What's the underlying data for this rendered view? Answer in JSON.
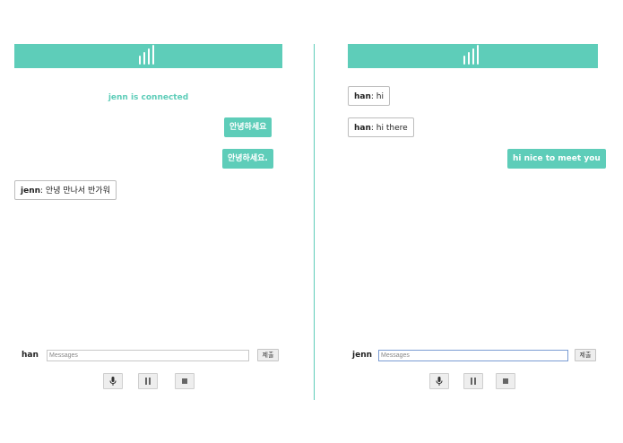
{
  "left": {
    "status": "jenn is connected",
    "messages": [
      {
        "type": "self",
        "text": "안녕하세요"
      },
      {
        "type": "self",
        "text": "안녕하세요."
      },
      {
        "type": "other",
        "sender": "jenn",
        "text": ": 안녕 만나서 반가워"
      }
    ],
    "username": "han",
    "input_placeholder": "Messages",
    "submit_label": "제출"
  },
  "right": {
    "messages": [
      {
        "type": "other",
        "sender": "han",
        "text": ": hi"
      },
      {
        "type": "other",
        "sender": "han",
        "text": ": hi there"
      },
      {
        "type": "self",
        "text": "hi nice to meet you"
      }
    ],
    "username": "jenn",
    "input_placeholder": "Messages",
    "submit_label": "제출"
  },
  "controls": [
    "microphone-icon",
    "pause-icon",
    "stop-icon"
  ],
  "colors": {
    "accent": "#5ecdb9",
    "status_text": "#5ecdb9"
  }
}
